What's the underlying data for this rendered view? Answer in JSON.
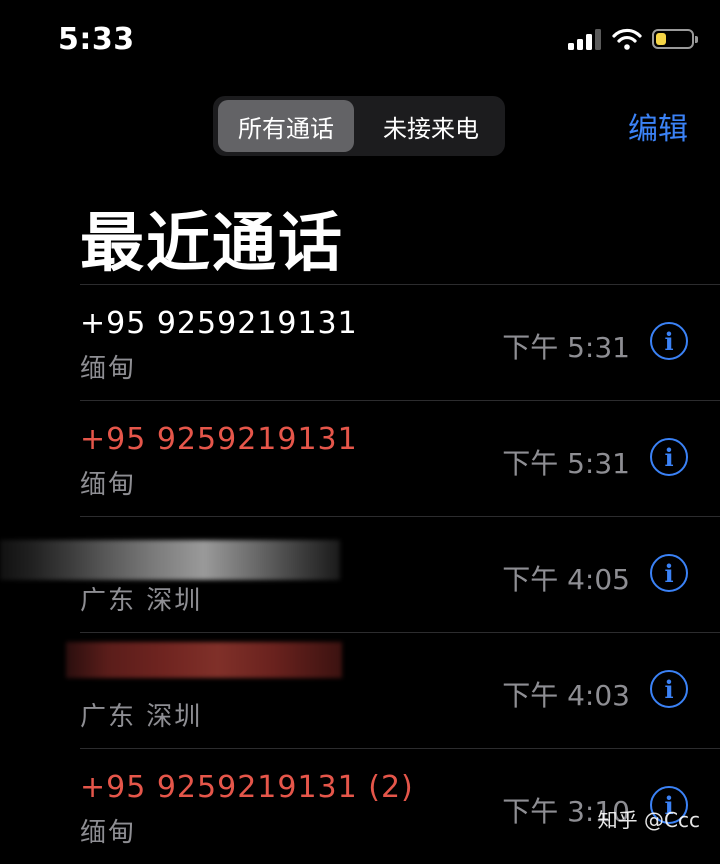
{
  "status_bar": {
    "time": "5:33",
    "battery_level": 0.3
  },
  "header": {
    "tabs": [
      {
        "label": "所有通话",
        "active": true
      },
      {
        "label": "未接来电",
        "active": false
      }
    ],
    "edit_label": "编辑"
  },
  "title": "最近通话",
  "calls": [
    {
      "number": "+95 9259219131",
      "location": "缅甸",
      "time": "下午 5:31",
      "missed": false
    },
    {
      "number": "+95 9259219131",
      "location": "缅甸",
      "time": "下午 5:31",
      "missed": true
    },
    {
      "number": "",
      "location": "广东 深圳",
      "time": "下午 4:05",
      "missed": false
    },
    {
      "number": "",
      "location": "广东 深圳",
      "time": "下午 4:03",
      "missed": true
    },
    {
      "number": "+95 9259219131 (2)",
      "location": "缅甸",
      "time": "下午 3:10",
      "missed": true
    }
  ],
  "colors": {
    "accent": "#3b82f6",
    "missed": "#e5564a",
    "secondary_text": "#8e8e93"
  },
  "watermark": "知乎 @Ccc"
}
